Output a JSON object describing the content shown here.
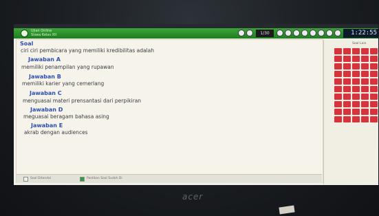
{
  "app": {
    "title_line1": "Ujian Online",
    "title_line2": "Siswa Kelas XII"
  },
  "header": {
    "page_counter": "1/30",
    "timer": "1:22:55"
  },
  "question": {
    "label": "Soal",
    "text": "ciri ciri pembicara yang memiliki kredibilitas adalah"
  },
  "answers": [
    {
      "label": "Jawaban A",
      "text": "memiliki penampilan yang rupawan"
    },
    {
      "label": "Jawaban B",
      "text": "memiliki karier yang cemerlang"
    },
    {
      "label": "Jawaban C",
      "text": "menguasai materi prensantasi dari perpikiran"
    },
    {
      "label": "Jawaban D",
      "text": "meguasai beragam bahasa asing"
    },
    {
      "label": "Jawaban E",
      "text": "akrab dengan audiences"
    }
  ],
  "panel": {
    "title": "Soal Lain",
    "cell_color": "#d8333c"
  },
  "footer": {
    "item1": "Soal Ditandai",
    "item2": "Pastikan Soal Sudah Di"
  },
  "device": {
    "brand": "acer"
  },
  "colors": {
    "titlebar": "#2b9a2f",
    "heading": "#2c4fb0",
    "timer_bg": "#0b1b2a"
  }
}
